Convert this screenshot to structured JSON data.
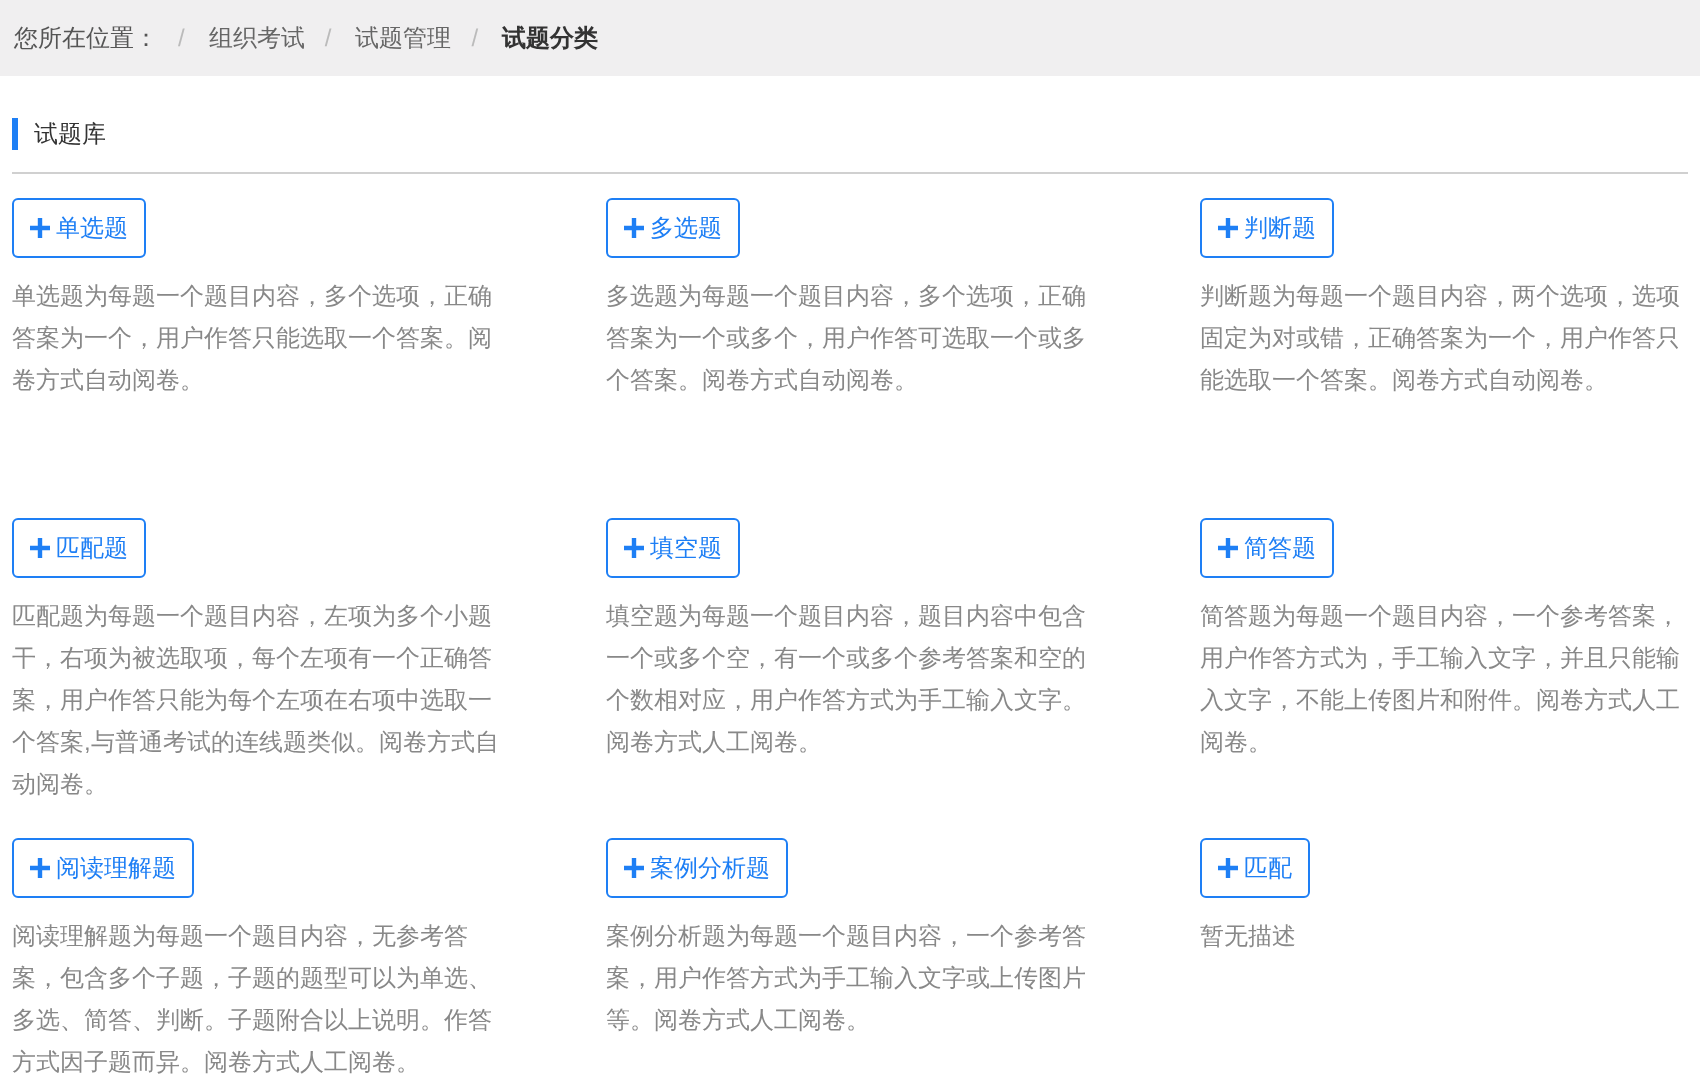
{
  "breadcrumb": {
    "label": "您所在位置：",
    "items": [
      {
        "separator": "/",
        "label": "组织考试",
        "current": false
      },
      {
        "separator": "/",
        "label": "试题管理",
        "current": false
      },
      {
        "separator": "/",
        "label": "试题分类",
        "current": true
      }
    ]
  },
  "section": {
    "title": "试题库"
  },
  "question_types": [
    {
      "button": "单选题",
      "description": "单选题为每题一个题目内容，多个选项，正确答案为一个，用户作答只能选取一个答案。阅卷方式自动阅卷。"
    },
    {
      "button": "多选题",
      "description": "多选题为每题一个题目内容，多个选项，正确答案为一个或多个，用户作答可选取一个或多个答案。阅卷方式自动阅卷。"
    },
    {
      "button": "判断题",
      "description": "判断题为每题一个题目内容，两个选项，选项固定为对或错，正确答案为一个，用户作答只能选取一个答案。阅卷方式自动阅卷。"
    },
    {
      "button": "匹配题",
      "description": "匹配题为每题一个题目内容，左项为多个小题干，右项为被选取项，每个左项有一个正确答案，用户作答只能为每个左项在右项中选取一个答案,与普通考试的连线题类似。阅卷方式自动阅卷。"
    },
    {
      "button": "填空题",
      "description": "填空题为每题一个题目内容，题目内容中包含一个或多个空，有一个或多个参考答案和空的个数相对应，用户作答方式为手工输入文字。阅卷方式人工阅卷。"
    },
    {
      "button": "简答题",
      "description": "简答题为每题一个题目内容，一个参考答案，用户作答方式为，手工输入文字，并且只能输入文字，不能上传图片和附件。阅卷方式人工阅卷。"
    },
    {
      "button": "阅读理解题",
      "description": "阅读理解题为每题一个题目内容，无参考答案，包含多个子题，子题的题型可以为单选、多选、简答、判断。子题附合以上说明。作答方式因子题而异。阅卷方式人工阅卷。"
    },
    {
      "button": "案例分析题",
      "description": "案例分析题为每题一个题目内容，一个参考答案，用户作答方式为手工输入文字或上传图片等。阅卷方式人工阅卷。"
    },
    {
      "button": "匹配",
      "description": "暂无描述"
    }
  ]
}
